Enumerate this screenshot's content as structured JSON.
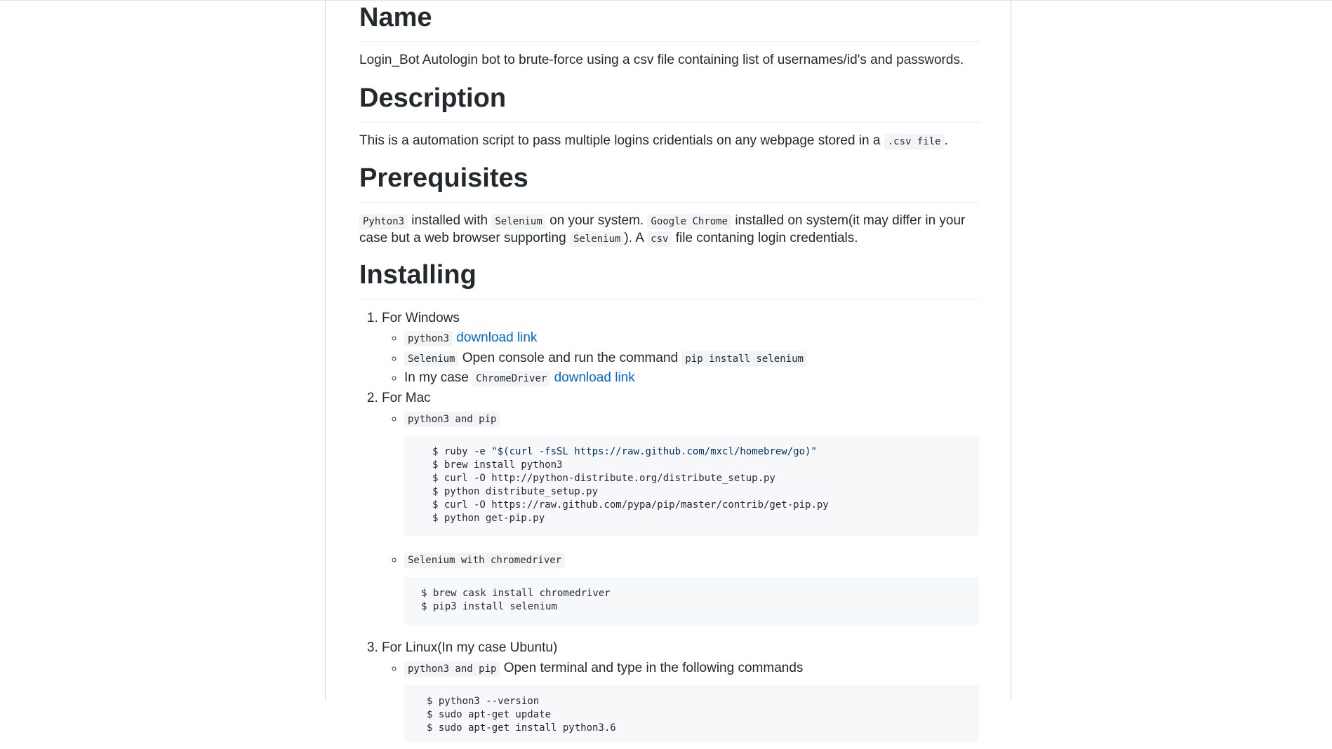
{
  "name": {
    "heading": "Name",
    "text": "Login_Bot Autologin bot to brute-force using a csv file containing list of usernames/id's and passwords."
  },
  "description": {
    "heading": "Description",
    "text_before": "This is a automation script to pass multiple logins cridentials on any webpage stored in a ",
    "code": ".csv file",
    "text_after": "."
  },
  "prerequisites": {
    "heading": "Prerequisites",
    "code1": "Pyhton3",
    "t1": " installed with ",
    "code2": "Selenium",
    "t2": " on your system. ",
    "code3": "Google Chrome",
    "t3": " installed on system(it may differ in your case but a web browser supporting ",
    "code4": "Selenium",
    "t4": "). A ",
    "code5": "csv",
    "t5": " file contaning login credentials."
  },
  "installing": {
    "heading": "Installing",
    "windows": {
      "label": "For Windows",
      "py_code": "python3",
      "py_link": "download link",
      "sel_code": "Selenium",
      "sel_text": " Open console and run the command ",
      "sel_cmd": "pip install selenium",
      "cd_text": "In my case ",
      "cd_code": "ChromeDriver",
      "cd_link": "download link"
    },
    "mac": {
      "label": "For Mac",
      "pip_code": "python3 and pip",
      "block1": {
        "l1_prefix": "$ ruby -e ",
        "l1_string": "\"$(curl -fsSL https://raw.github.com/mxcl/homebrew/go)\"",
        "l2": "$ brew install python3",
        "l3": "$ curl -O http://python-distribute.org/distribute_setup.py",
        "l4": "$ python distribute_setup.py",
        "l5": "$ curl -O https://raw.github.com/pypa/pip/master/contrib/get-pip.py",
        "l6": "$ python get-pip.py"
      },
      "sel_code": "Selenium with chromedriver",
      "block2": {
        "l1": "$ brew cask install chromedriver",
        "l2": "$ pip3 install selenium"
      }
    },
    "linux": {
      "label": "For Linux(In my case Ubuntu)",
      "pip_code": "python3 and pip",
      "pip_text": " Open terminal and type in the following commands",
      "block": {
        "l1": "$ python3 --version",
        "l2": "$ sudo apt-get update",
        "l3": "$ sudo apt-get install python3.6"
      }
    }
  }
}
